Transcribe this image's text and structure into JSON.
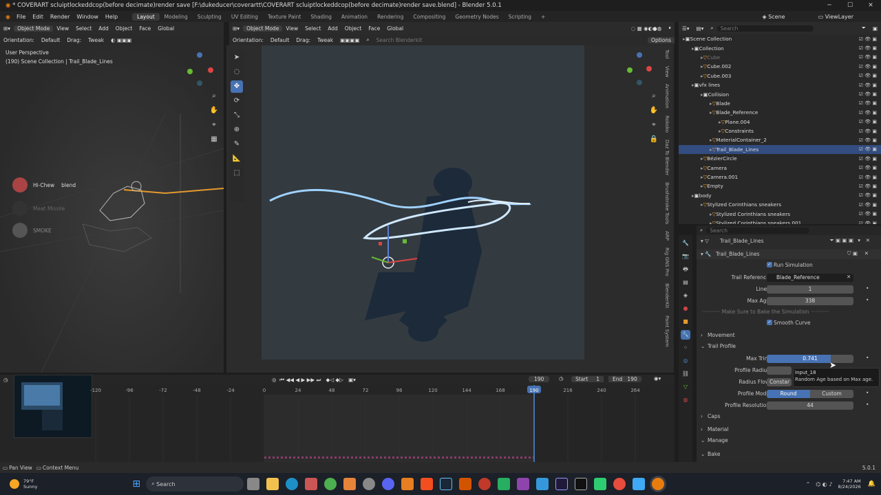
{
  "titlebar": {
    "title": "* COVERART scluiptlockeddcop(before decimate)render save [F:\\dukeducer\\coverartt\\COVERART scluiptlockeddcop(before decimate)render save.blend] - Blender 5.0.1"
  },
  "menu": [
    "File",
    "Edit",
    "Render",
    "Window",
    "Help"
  ],
  "workspaces": [
    "Layout",
    "Modeling",
    "Sculpting",
    "UV Editing",
    "Texture Paint",
    "Shading",
    "Animation",
    "Rendering",
    "Compositing",
    "Geometry Nodes",
    "Scripting"
  ],
  "scene_label": "Scene",
  "viewlayer_label": "ViewLayer",
  "left_header": {
    "mode": "Object Mode",
    "menus": [
      "View",
      "Select",
      "Add",
      "Object",
      "Face"
    ],
    "transform": "Global"
  },
  "left_subheader": {
    "orientation_label": "Orientation:",
    "orientation": "Default",
    "drag_label": "Drag:",
    "drag": "Tweak"
  },
  "left_view": {
    "perspective": "User Perspective",
    "collection": "(190) Scene Collection | Trail_Blade_Lines"
  },
  "left_overlay": {
    "items": [
      "Hi-Chew",
      "blend",
      "Meat Missile",
      "SMOKE"
    ]
  },
  "mid_header": {
    "mode": "Object Mode",
    "menus": [
      "View",
      "Select",
      "Add",
      "Object",
      "Face"
    ],
    "transform": "Global"
  },
  "mid_subheader": {
    "orientation_label": "Orientation:",
    "orientation": "Default",
    "drag_label": "Drag:",
    "drag": "Tweak",
    "search_placeholder": "Search Blenderkit",
    "options": "Options"
  },
  "side_tabs": [
    "Tool",
    "View",
    "Animation",
    "Rokoko",
    "Daz To Blender",
    "Brushstroke Tools",
    "ARP",
    "Rig GNS Pro",
    "BlenderKit",
    "Paint System"
  ],
  "outliner": {
    "search_placeholder": "Search",
    "rows": [
      {
        "label": "Scene Collection",
        "indent": 0
      },
      {
        "label": "Collection",
        "indent": 1
      },
      {
        "label": "Cube",
        "indent": 2,
        "dim": true
      },
      {
        "label": "Cube.002",
        "indent": 2
      },
      {
        "label": "Cube.003",
        "indent": 2
      },
      {
        "label": "vfx lines",
        "indent": 1
      },
      {
        "label": "Collision",
        "indent": 2
      },
      {
        "label": "Blade",
        "indent": 3
      },
      {
        "label": "Blade_Reference",
        "indent": 3
      },
      {
        "label": "Plane.004",
        "indent": 4
      },
      {
        "label": "Constraints",
        "indent": 4
      },
      {
        "label": "MaterialContainer_2",
        "indent": 3
      },
      {
        "label": "Trail_Blade_Lines",
        "indent": 3,
        "selected": true
      },
      {
        "label": "BézierCircle",
        "indent": 2
      },
      {
        "label": "Camera",
        "indent": 2
      },
      {
        "label": "Camera.001",
        "indent": 2
      },
      {
        "label": "Empty",
        "indent": 2
      },
      {
        "label": "body",
        "indent": 1
      },
      {
        "label": "Stylized Corinthians sneakers",
        "indent": 2
      },
      {
        "label": "Stylized Corinthians sneakers",
        "indent": 3
      },
      {
        "label": "Stylized Corinthians sneakers.001",
        "indent": 3
      }
    ]
  },
  "properties": {
    "search_placeholder": "Search",
    "object_name": "Trail_Blade_Lines",
    "modifier_name": "Trail_Blade_Lines",
    "run_simulation": "Run Simulation",
    "trail_reference_label": "Trail Reference",
    "trail_reference_value": "Blade_Reference",
    "lines_label": "Lines",
    "lines_value": "1",
    "max_age_label": "Max Age",
    "max_age_value": "338",
    "bake_note": "Make Sure to Bake the Simulation",
    "smooth_curve": "Smooth Curve",
    "movement": "Movement",
    "trail_profile": "Trail Profile",
    "max_trim_label": "Max Trim",
    "max_trim_value": "0.741",
    "max_trim_fraction": 0.741,
    "profile_radius_label": "Profile Radius",
    "radius_flow_label": "Radius Flow",
    "radius_flow_value": "Constar",
    "tooltip_title": "Input_18",
    "tooltip_text": "Random Age based on Max age.",
    "profile_mode_label": "Profile Mode",
    "profile_mode_round": "Round",
    "profile_mode_custom": "Custom",
    "profile_resolution_label": "Profile Resolution",
    "profile_resolution_value": "44",
    "caps": "Caps",
    "material": "Material",
    "manage": "Manage",
    "bake": "Bake"
  },
  "timeline": {
    "current_frame": "190",
    "start_label": "Start",
    "start": "1",
    "end_label": "End",
    "end": "190",
    "ticks": [
      "-120",
      "-96",
      "-72",
      "-48",
      "-24",
      "0",
      "24",
      "48",
      "72",
      "96",
      "120",
      "144",
      "168",
      "190",
      "216",
      "240",
      "264"
    ]
  },
  "statusbar": {
    "pan": "Pan View",
    "context": "Context Menu",
    "version": "5.0.1"
  },
  "taskbar": {
    "weather_temp": "79°F",
    "weather_desc": "Sunny",
    "search": "Search",
    "time": "7:47 AM",
    "date": "8/24/2026"
  },
  "colors": {
    "accent": "#4772b3",
    "selected_row": "#334d80",
    "timeline_marker": "#4772b3",
    "orange": "#e69a2e"
  }
}
